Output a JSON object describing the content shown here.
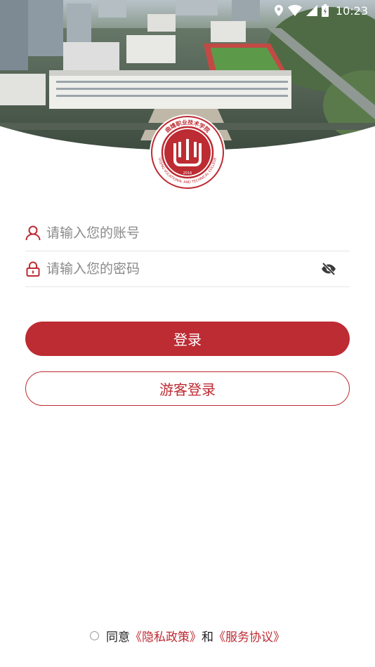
{
  "status_bar": {
    "time": "10:23",
    "icons": [
      "location-icon",
      "wifi-icon",
      "signal-icon",
      "battery-icon"
    ]
  },
  "logo": {
    "name": "qujing-vocational-technical-college-logo",
    "text_cn": "曲靖职业技术学院",
    "text_en": "QUJING VOCATIONAL AND TECHNICAL COLLEGE",
    "year": "2016"
  },
  "form": {
    "account": {
      "placeholder": "请输入您的账号",
      "value": ""
    },
    "password": {
      "placeholder": "请输入您的密码",
      "value": ""
    }
  },
  "buttons": {
    "login": "登录",
    "guest_login": "游客登录"
  },
  "agreement": {
    "prefix": "同意",
    "privacy_link": "《隐私政策》",
    "conjunction": "和",
    "service_link": "《服务协议》",
    "checked": false
  },
  "colors": {
    "accent": "#bd2b33",
    "divider": "#e6e6e6",
    "placeholder": "#8a8a8a"
  }
}
